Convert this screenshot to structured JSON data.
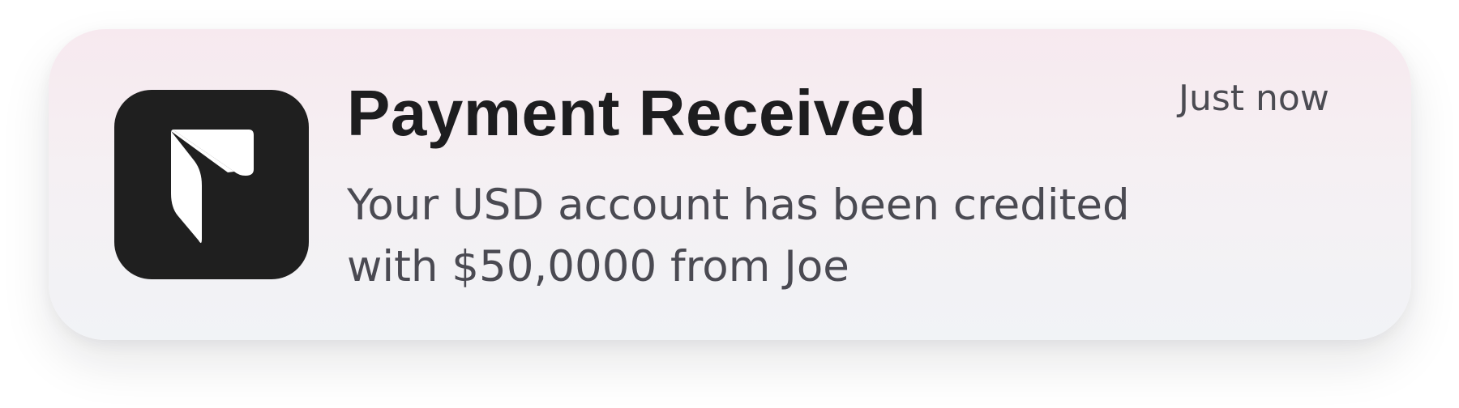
{
  "notification": {
    "app_icon": "payment-app-logo-icon",
    "title": "Payment Received",
    "timestamp": "Just now",
    "message_lines": [
      "Your USD account has been credited",
      "with $50,0000 from Joe"
    ]
  },
  "colors": {
    "icon_background": "#1f1f1f",
    "icon_glyph": "#ffffff",
    "title": "#1d1d1f",
    "secondary_text": "#4a4a52"
  }
}
